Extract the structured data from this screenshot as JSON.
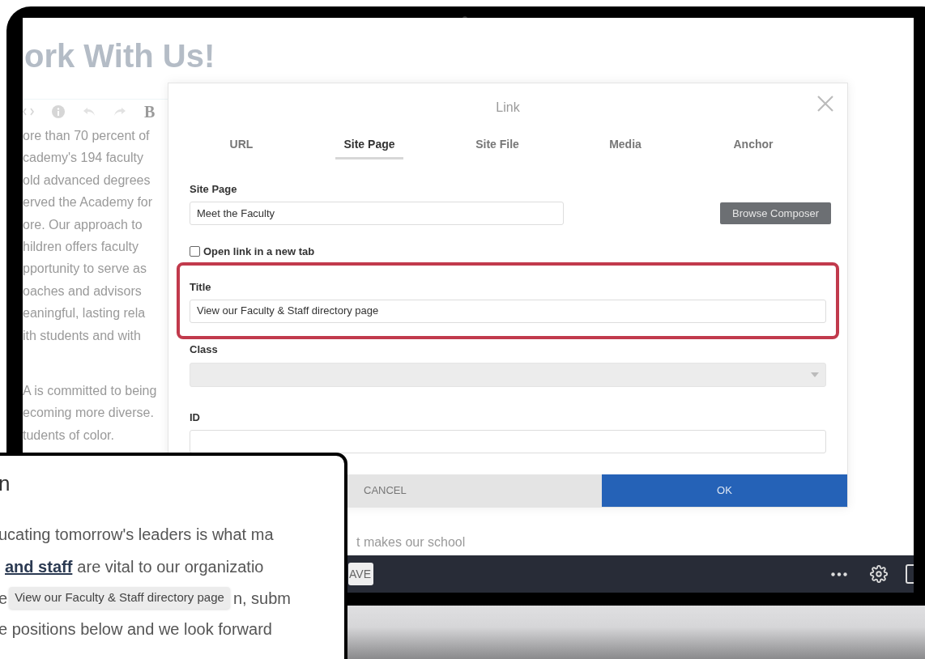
{
  "page": {
    "heading": "ork With Us!",
    "editor_toolbar": {
      "bold": "B"
    },
    "paragraph_1": [
      "ore than 70 percent of",
      "cademy's 194 faculty",
      "old advanced degrees",
      "erved the Academy for",
      "ore. Our approach to",
      "hildren offers faculty",
      "pportunity to serve as",
      "oaches and advisors",
      "eaningful, lasting rela",
      "ith students and with"
    ],
    "paragraph_2": [
      "A is committed to being",
      "ecoming more diverse.",
      "tudents of color."
    ],
    "fragment": "t makes our school"
  },
  "dialog": {
    "title": "Link",
    "tabs": [
      {
        "label": "URL",
        "selected": false
      },
      {
        "label": "Site Page",
        "selected": true
      },
      {
        "label": "Site File",
        "selected": false
      },
      {
        "label": "Media",
        "selected": false
      },
      {
        "label": "Anchor",
        "selected": false
      }
    ],
    "site_page": {
      "label": "Site Page",
      "value": "Meet the Faculty"
    },
    "browse_button": "Browse Composer",
    "new_tab": {
      "label": "Open link in a new tab",
      "checked": false
    },
    "title_field": {
      "label": "Title",
      "value": "View our Faculty & Staff directory page",
      "highlighted": true
    },
    "class_field": {
      "label": "Class",
      "disabled": true
    },
    "id_field": {
      "label": "ID"
    },
    "cancel_button": "CANCEL",
    "ok_button": "OK"
  },
  "bottom_toolbar": {
    "save_button": "AVE"
  },
  "inset": {
    "heading": "n",
    "line_1": "ucating tomorrow's leaders is what ma",
    "line_2": {
      "link": "and staff",
      "text": "are vital to our organizatio"
    },
    "line_3": {
      "before": "e",
      "tooltip": "View our Faculty & Staff directory page",
      "after": "n, subm"
    },
    "line_4": "e positions below and we look forward"
  }
}
